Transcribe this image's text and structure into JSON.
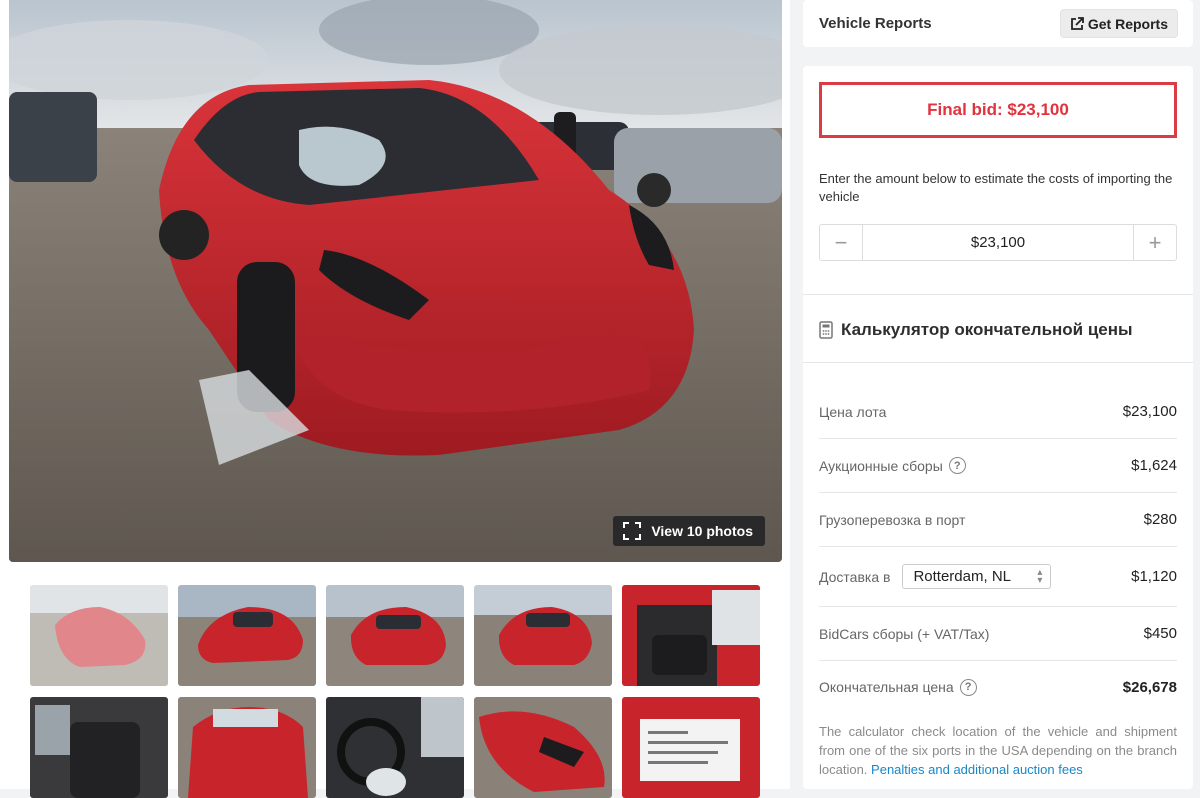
{
  "gallery": {
    "view_photos_label": "View 10 photos",
    "thumbnail_count": 10
  },
  "reports": {
    "title": "Vehicle Reports",
    "button_label": "Get Reports"
  },
  "bid": {
    "final_bid_label": "Final bid: $23,100",
    "hint": "Enter the amount below to estimate the costs of importing the vehicle",
    "amount_value": "$23,100",
    "minus": "−",
    "plus": "+"
  },
  "calculator": {
    "title": "Калькулятор окончательной цены",
    "rows": [
      {
        "label": "Цена лота",
        "amount": "$23,100"
      },
      {
        "label": "Аукционные сборы",
        "amount": "$1,624",
        "help": "?"
      },
      {
        "label": "Грузоперевозка в порт",
        "amount": "$280"
      },
      {
        "label": "Доставка в",
        "amount": "$1,120",
        "select_value": "Rotterdam, NL"
      },
      {
        "label": "BidCars сборы (+ VAT/Tax)",
        "amount": "$450"
      },
      {
        "label": "Окончательная цена",
        "amount": "$26,678",
        "help": "?"
      }
    ],
    "note": "The calculator check location of the vehicle and shipment from one of the six ports in the USA depending on the branch location.",
    "note_link": "Penalties and additional auction fees"
  },
  "colors": {
    "accent_red": "#dc3b45",
    "link_blue": "#1688c9",
    "car_red": "#c8242b"
  }
}
